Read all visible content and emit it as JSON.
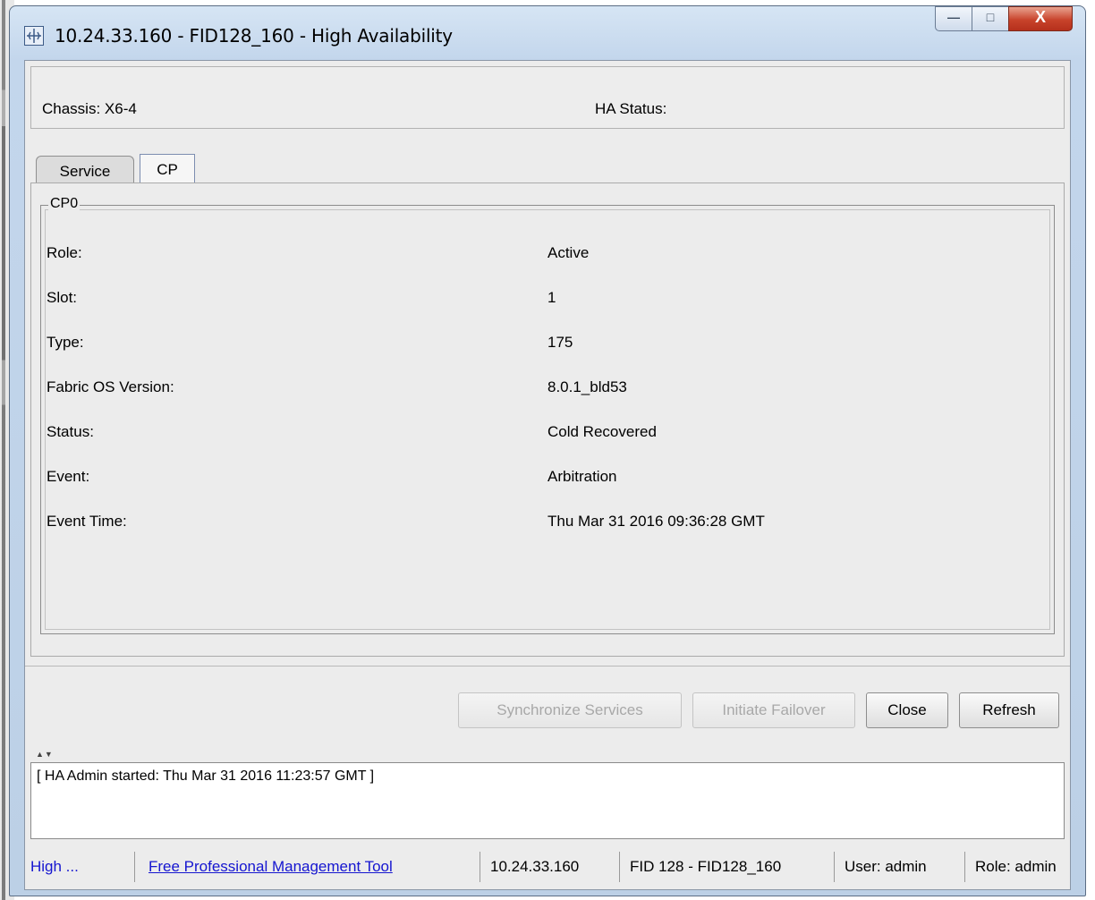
{
  "window": {
    "title": "10.24.33.160 - FID128_160 - High Availability",
    "controls": {
      "minimize": "—",
      "maximize": "□",
      "close": "X"
    }
  },
  "header": {
    "chassis": "Chassis:  X6-4",
    "ha_status": "HA Status:"
  },
  "tabs": [
    {
      "label": "Service",
      "selected": false
    },
    {
      "label": "CP",
      "selected": true
    }
  ],
  "cp_panel": {
    "legend": "CP0",
    "rows": [
      {
        "label": "Role:",
        "value": "Active"
      },
      {
        "label": "Slot:",
        "value": "1"
      },
      {
        "label": "Type:",
        "value": "175"
      },
      {
        "label": "Fabric OS Version:",
        "value": "8.0.1_bld53"
      },
      {
        "label": "Status:",
        "value": "Cold Recovered"
      },
      {
        "label": "Event:",
        "value": "Arbitration"
      },
      {
        "label": "Event Time:",
        "value": "Thu Mar 31 2016 09:36:28 GMT"
      }
    ]
  },
  "buttons": {
    "synchronize": "Synchronize Services",
    "failover": "Initiate Failover",
    "close": "Close",
    "refresh": "Refresh"
  },
  "log": {
    "text": "[ HA Admin started: Thu Mar 31 2016 11:23:57 GMT ]"
  },
  "statusbar": {
    "link_short": "High ...",
    "link_tool": "Free Professional Management Tool",
    "ip": "10.24.33.160",
    "fid": "FID 128 - FID128_160",
    "user": "User: admin",
    "role": "Role: admin"
  }
}
